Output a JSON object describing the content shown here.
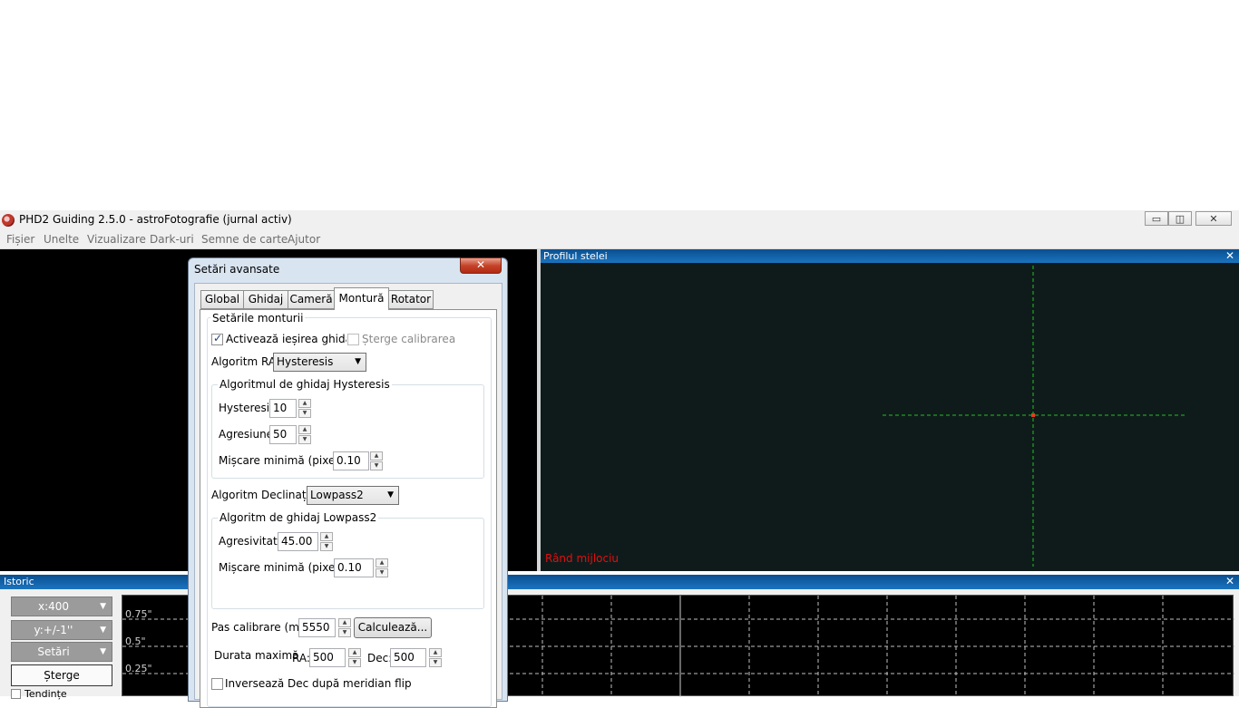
{
  "window": {
    "title": "PHD2 Guiding 2.5.0 - astroFotografie (jurnal activ)",
    "controls": {
      "minimize": "▭",
      "maximize": "◫",
      "close": "✕"
    }
  },
  "menu": [
    "Fișier",
    "Unelte",
    "Vizualizare",
    "Dark-uri",
    "Semne de carte",
    "Ajutor"
  ],
  "profile": {
    "title": "Profilul stelei",
    "close": "✕",
    "footer": "Rând mijlociu",
    "crosshair_color": "#22c022",
    "footer_color": "#e01010"
  },
  "history": {
    "title": "Istoric",
    "close": "✕",
    "x_scale": "x:400",
    "y_scale": "y:+/-1''",
    "settings": "Setări",
    "clear": "Șterge",
    "trends": "Tendințe",
    "y_labels": [
      "0.75\"",
      "0.5\"",
      "0.25\""
    ]
  },
  "dialog": {
    "title": "Setări avansate",
    "close": "✕",
    "tabs": [
      "Global",
      "Ghidaj",
      "Cameră",
      "Montură",
      "Rotator"
    ],
    "active_tab": "Montură",
    "mount_group": "Setările monturii",
    "enable_guide_output": "Activează ieșirea ghidajului",
    "enable_guide_output_checked": true,
    "clear_calibration": "Șterge calibrarea",
    "clear_calibration_checked": false,
    "ra_algo_label": "Algoritm RA:",
    "ra_algo_value": "Hysteresis",
    "hyst_group": "Algoritmul de ghidaj Hysteresis",
    "hysteresis_label": "Hysteresis:",
    "hysteresis_value": "10",
    "aggression_label": "Agresiune:",
    "aggression_value": "50",
    "min_move_label": "Mișcare minimă (pixeli):",
    "min_move_value": "0.10",
    "dec_algo_label": "Algoritm Declinație:",
    "dec_algo_value": "Lowpass2",
    "lp_group": "Algoritm de ghidaj Lowpass2",
    "aggressiveness_label": "Agresivitate:",
    "aggressiveness_value": "45.00",
    "min_move2_label": "Mișcare minimă (pixeli):",
    "min_move2_value": "0.10",
    "calib_step_label": "Pas calibrare (ms):",
    "calib_step_value": "5550",
    "calculate_button": "Calculează...",
    "max_duration_label": "Durata maximă",
    "ra_label": "RA:",
    "ra_value": "500",
    "dec_label": "Dec:",
    "dec_value": "500",
    "reverse_dec": "Inversează Dec după meridian flip",
    "reverse_dec_checked": false
  }
}
